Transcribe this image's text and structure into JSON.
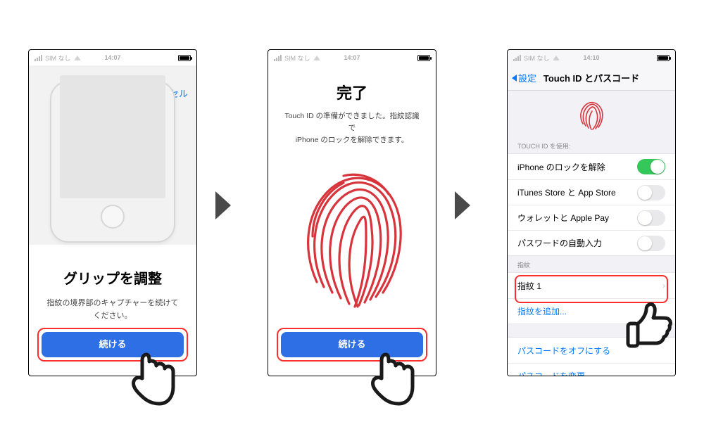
{
  "screen1": {
    "status": {
      "carrier": "SIM なし",
      "time": "14:07"
    },
    "cancel": "キャンセル",
    "title": "グリップを調整",
    "desc": "指紋の境界部のキャプチャーを続けてください。",
    "cta": "続ける"
  },
  "screen2": {
    "status": {
      "carrier": "SIM なし",
      "time": "14:07"
    },
    "title": "完了",
    "desc_line1": "Touch ID の準備ができました。指紋認識で",
    "desc_line2": "iPhone のロックを解除できます。",
    "cta": "続ける"
  },
  "screen3": {
    "status": {
      "carrier": "SIM なし",
      "time": "14:10"
    },
    "back_label": "設定",
    "nav_title": "Touch ID とパスコード",
    "group_use_label": "TOUCH ID を使用:",
    "toggles": [
      {
        "label": "iPhone のロックを解除",
        "on": true
      },
      {
        "label": "iTunes Store と App Store",
        "on": false
      },
      {
        "label": "ウォレットと Apple Pay",
        "on": false
      },
      {
        "label": "パスワードの自動入力",
        "on": false
      }
    ],
    "fingerprints_label": "指紋",
    "fingerprint_row": "指紋 1",
    "add_fingerprint": "指紋を追加...",
    "passcode_off": "パスコードをオフにする",
    "passcode_change": "パスコードを変更"
  }
}
